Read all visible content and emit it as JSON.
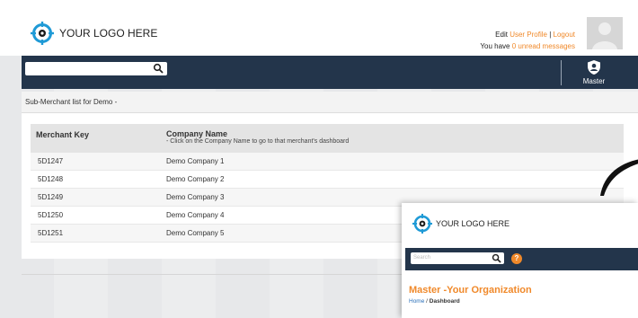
{
  "header": {
    "logo_text": "YOUR LOGO HERE",
    "edit_prefix": "Edit",
    "user_profile": "User Profile",
    "separator": "|",
    "logout": "Logout",
    "msg_prefix": "You have",
    "unread": "0 unread messages"
  },
  "nav": {
    "search_placeholder": "",
    "master_label": "Master"
  },
  "panel": {
    "title": "Sub-Merchant list for Demo -",
    "col1": "Merchant Key",
    "col2": "Company Name",
    "col2_sub": "- Click on the Company Name to go to that merchant's dashboard",
    "rows": [
      {
        "key": "5D1247",
        "company": "Demo Company 1"
      },
      {
        "key": "5D1248",
        "company": "Demo Company 2"
      },
      {
        "key": "5D1249",
        "company": "Demo Company 3"
      },
      {
        "key": "5D1250",
        "company": "Demo Company 4"
      },
      {
        "key": "5D1251",
        "company": "Demo Company 5"
      }
    ]
  },
  "front": {
    "logo_text": "YOUR LOGO HERE",
    "search_placeholder": "Search",
    "help": "?",
    "title": "Master -Your Organization",
    "crumb_home": "Home",
    "crumb_sep": "/",
    "crumb_current": "Dashboard"
  },
  "colors": {
    "nav": "#23354b",
    "accent": "#f0892a",
    "logo": "#1f9ad6"
  }
}
